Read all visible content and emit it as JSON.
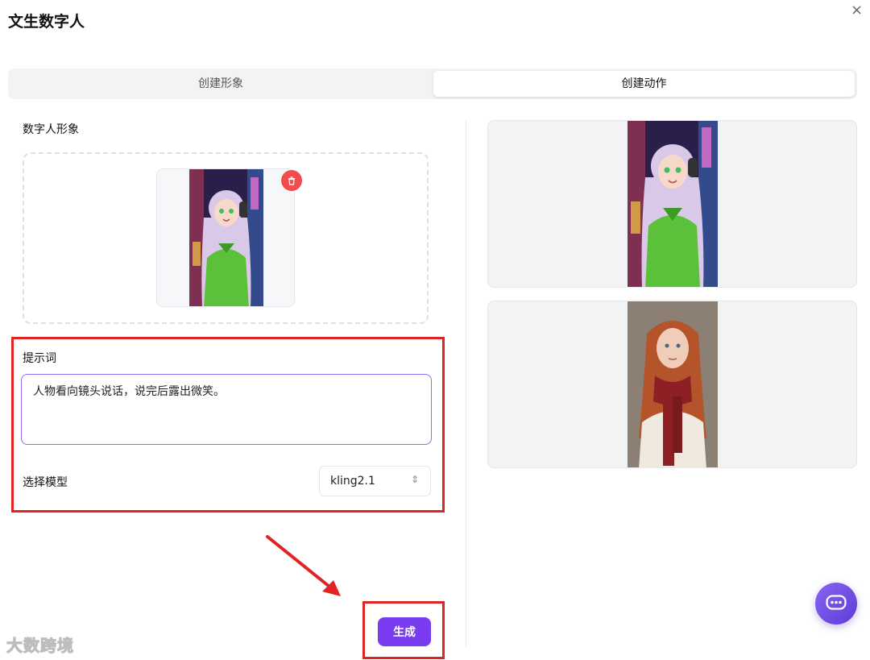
{
  "header": {
    "title": "文生数字人",
    "close_glyph": "×"
  },
  "tabs": [
    {
      "label": "创建形象",
      "active": false
    },
    {
      "label": "创建动作",
      "active": true
    }
  ],
  "left_panel": {
    "avatar_section_label": "数字人形象",
    "uploaded_image": {
      "kind": "anime-girl-headphones-green-hoodie"
    },
    "prompt_label": "提示词",
    "prompt_value": "人物看向镜头说话，说完后露出微笑。",
    "model_label": "选择模型",
    "model_value": "kling2.1",
    "generate_label": "生成"
  },
  "gallery": [
    {
      "kind": "anime-girl-headphones-green-hoodie"
    },
    {
      "kind": "red-haired-woman-red-scarf"
    }
  ],
  "watermark": "大数跨境",
  "colors": {
    "accent": "#7a3cf0",
    "annotation_red": "#e02424",
    "focus_border": "#8b6cf0",
    "delete_red": "#f24d4d"
  }
}
